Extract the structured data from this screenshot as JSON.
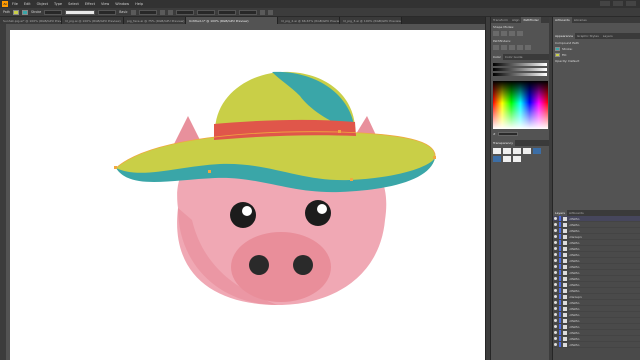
{
  "app": {
    "logo": "Ai",
    "menu": [
      "File",
      "Edit",
      "Object",
      "Type",
      "Select",
      "Effect",
      "View",
      "Window",
      "Help"
    ]
  },
  "control_bar": {
    "label": "Path",
    "stroke_label": "Stroke",
    "style_label": "Basic"
  },
  "tabs": [
    {
      "label": "Sunhat-pig.ai* @ 100% (RGB/GPU Preview)",
      "active": false
    },
    {
      "label": "ld_pig.ai @ 100% (RGB/GPU Preview)",
      "active": false
    },
    {
      "label": "pig_face.ai @ 75% (RGB/GPU Preview)",
      "active": false
    },
    {
      "label": "Untitled-1* @ 100% (RGB/GPU Preview)",
      "active": true
    },
    {
      "label": "ld_pig_2.ai @ 66.67% (RGB/GPU Preview)",
      "active": false
    },
    {
      "label": "ld_pig_3.ai @ 100% (RGB/GPU Preview)",
      "active": false
    }
  ],
  "panel_col2": {
    "tabs": [
      "Transform",
      "Align",
      "Pathfinder"
    ],
    "shape_modes": "Shape Modes:",
    "pathfinders": "Pathfinders:",
    "color_tabs": [
      "Color",
      "Color Guide"
    ],
    "hex_prefix": "#",
    "transparency_tabs": [
      "Transparency"
    ]
  },
  "panel_col4": {
    "tabs": [
      "Artboards",
      "Libraries"
    ],
    "appearance_tabs": [
      "Appearance",
      "Graphic Styles",
      "Layers"
    ],
    "appearance_rows": [
      "Compound Path",
      "Stroke:",
      "Fill:",
      "Opacity: Default"
    ],
    "layers_tabs": [
      "Layers",
      "Artboards"
    ],
    "layers": [
      "<Path>",
      "<Path>",
      "<Path>",
      "<Group>",
      "<Path>",
      "<Path>",
      "<Path>",
      "<Path>",
      "<Path>",
      "<Path>",
      "<Path>",
      "<Path>",
      "<Path>",
      "<Group>",
      "<Path>",
      "<Path>",
      "<Path>",
      "<Path>",
      "<Path>",
      "<Path>",
      "<Path>",
      "<Path>"
    ]
  },
  "colors": {
    "pig_pink": "#e8909c",
    "pig_face": "#f0a8b4",
    "hat_yellow": "#c9cf47",
    "hat_teal": "#3aa6a8",
    "hat_band": "#e0564a",
    "accent_selection": "#f0a840"
  }
}
